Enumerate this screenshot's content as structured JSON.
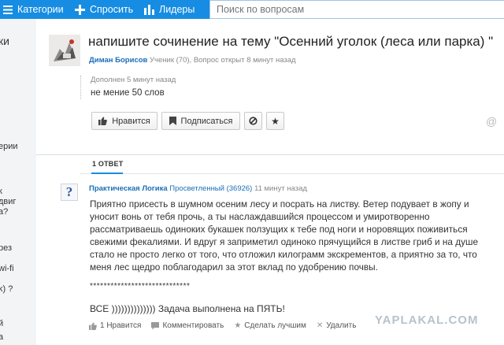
{
  "nav": {
    "categories": "Категории",
    "ask": "Спросить",
    "leaders": "Лидеры",
    "search_placeholder": "Поиск по вопросам"
  },
  "sidebar": {
    "items": [
      "ки",
      "ерии",
      "к",
      "двиг",
      "а?",
      "рез",
      "wi-fi",
      "k) ?",
      "й",
      "а"
    ]
  },
  "question": {
    "title": "напишите сочинение на тему \"Осенний уголок (леса или парка) \"",
    "author": "Диман Борисов",
    "author_rank": "Ученик (70),",
    "status": "Вопрос открыт 8 минут назад",
    "addition_label": "Дополнен 5 минут назад",
    "addition_text": "не мение 50 слов",
    "like_label": "Нравится",
    "subscribe_label": "Подписаться"
  },
  "answers": {
    "tab_label": "1 ОТВЕТ",
    "item": {
      "author": "Практическая Логика",
      "rank": "Просветленный (36926)",
      "time": "11 минут назад",
      "text": "Приятно присесть в шумном осеним лесу и посрать на листву. Ветер подувает в жопу и уносит вонь от тебя прочь, а ты наслаждавшийся процессом и умиротворенно рассматриваешь одиноких букашек ползущих к тебе под ноги и норовящих поживиться свежими фекалиями. И вдруг я заприметил одиноко прячущийся в листве гриб и на душе стало не просто легко от того, что отложил килограмм экскрементов, а приятно за то, что меня лес щедро поблагодарил за этот вклад по удобрению почвы.",
      "separator": "*****************************",
      "final_line": "ВСЕ )))))))))))))) Задача выполнена на ПЯТЬ!",
      "likes": "1 Нравится",
      "comment": "Комментировать",
      "favorite": "Сделать лучшим",
      "delete": "Удалить"
    }
  },
  "watermark": "YAPLAKAL.COM",
  "colors": {
    "topbar": "#168de2",
    "link": "#1a6fb8",
    "background": "#e9ecef"
  }
}
